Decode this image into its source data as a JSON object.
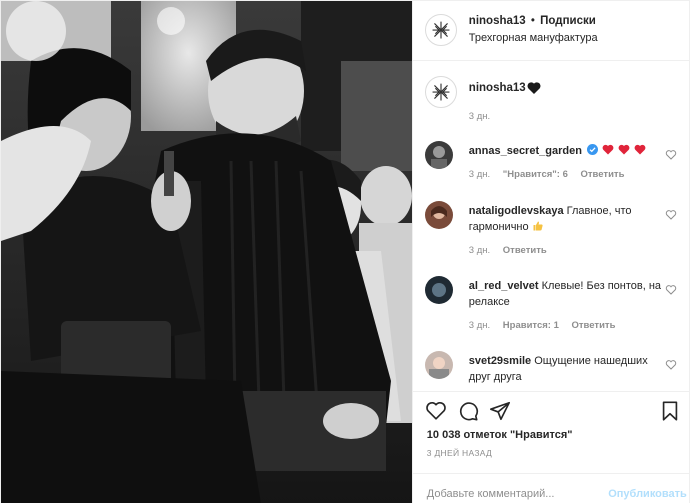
{
  "header": {
    "username": "ninosha13",
    "separator": "•",
    "follow_label": "Подписки",
    "location": "Трехгорная мануфактура"
  },
  "caption": {
    "username": "ninosha13",
    "time": "3 дн."
  },
  "comments": [
    {
      "username": "annas_secret_garden",
      "text": "",
      "verified": true,
      "red_hearts": 3,
      "time": "3 дн.",
      "likes": "\"Нравится\": 6",
      "reply": "Ответить"
    },
    {
      "username": "nataligodlevskaya",
      "text": "Главное, что гармонично",
      "time": "3 дн.",
      "reply": "Ответить"
    },
    {
      "username": "al_red_velvet",
      "text": "Клевые! Без понтов, на релаксе",
      "time": "3 дн.",
      "likes": "Нравится: 1",
      "reply": "Ответить"
    },
    {
      "username": "svet29smile",
      "text": "Ощущение нашедших друг друга"
    }
  ],
  "actions": {
    "like_icon": "heart-outline-icon",
    "comment_icon": "comment-icon",
    "share_icon": "share-icon",
    "save_icon": "bookmark-icon"
  },
  "likes_count": "10 038 отметок \"Нравится\"",
  "post_date": "3 ДНЕЙ НАЗАД",
  "add_comment": {
    "placeholder": "Добавьте комментарий...",
    "publish_label": "Опубликовать"
  },
  "colors": {
    "link_blue": "#0095f6",
    "publish_disabled": "#b2dffc",
    "muted": "#8e8e8e",
    "heart_red": "#ed4956"
  }
}
